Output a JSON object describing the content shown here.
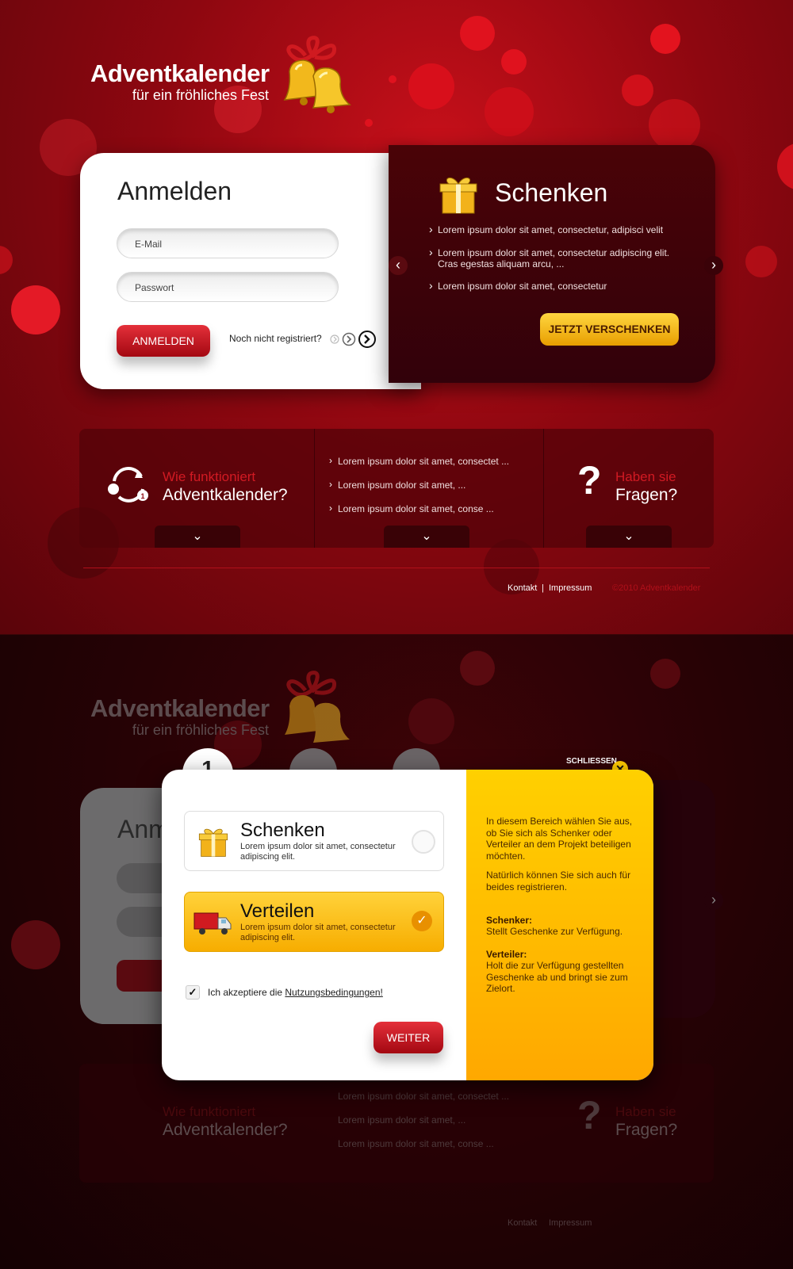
{
  "brand": {
    "title": "Adventkalender",
    "subtitle": "für ein fröhliches Fest"
  },
  "login": {
    "heading": "Anmelden",
    "email_placeholder": "E-Mail",
    "password_placeholder": "Passwort",
    "submit_label": "ANMELDEN",
    "register_text": "Noch nicht registriert?"
  },
  "gift": {
    "heading": "Schenken",
    "bullets": [
      "Lorem ipsum dolor sit amet, consectetur, adipisci velit",
      "Lorem ipsum dolor sit amet, consectetur adipiscing elit. Cras egestas aliquam arcu, ...",
      "Lorem ipsum dolor sit amet, consectetur"
    ],
    "cta_label": "JETZT VERSCHENKEN"
  },
  "info": {
    "how_small": "Wie funktioniert",
    "how_big": "Adventkalender?",
    "list": [
      "Lorem ipsum dolor sit amet, consectet ...",
      "Lorem ipsum dolor sit amet, ...",
      "Lorem ipsum dolor sit amet, conse ..."
    ],
    "faq_small": "Haben sie",
    "faq_big": "Fragen?"
  },
  "footer": {
    "contact": "Kontakt",
    "sep": "|",
    "imprint": "Impressum",
    "copyright": "©2010 Adventkalender"
  },
  "modal": {
    "step": "1",
    "close_label": "SCHLIESSEN",
    "options": [
      {
        "title": "Schenken",
        "desc": "Lorem ipsum dolor sit amet, consectetur adipiscing elit.",
        "selected": false
      },
      {
        "title": "Verteilen",
        "desc": "Lorem ipsum dolor sit amet, consectetur adipiscing elit.",
        "selected": true
      }
    ],
    "terms_prefix": "Ich akzeptiere die ",
    "terms_link": "Nutzungsbedingungen!",
    "terms_checked": true,
    "next_label": "WEITER",
    "help_p1": "In diesem Bereich wählen Sie aus, ob Sie sich als Schenker oder Verteiler an dem Projekt beteiligen möchten.",
    "help_p2": "Natürlich können Sie sich auch für beides registrieren.",
    "schenker_label": "Schenker:",
    "schenker_text": "Stellt Geschenke zur Verfügung.",
    "verteiler_label": "Verteiler:",
    "verteiler_text": "Holt die zur Verfügung gestellten Geschenke ab und bringt sie zum Zielort."
  },
  "colors": {
    "brand_red": "#c8101a",
    "gold": "#ffc400",
    "dark_panel": "#4a0307"
  },
  "icons": [
    "bells-icon",
    "gift-icon",
    "cycle-icon",
    "question-icon",
    "chevron-down-icon",
    "chevron-left-icon",
    "chevron-right-icon",
    "truck-icon",
    "check-icon",
    "close-icon"
  ]
}
